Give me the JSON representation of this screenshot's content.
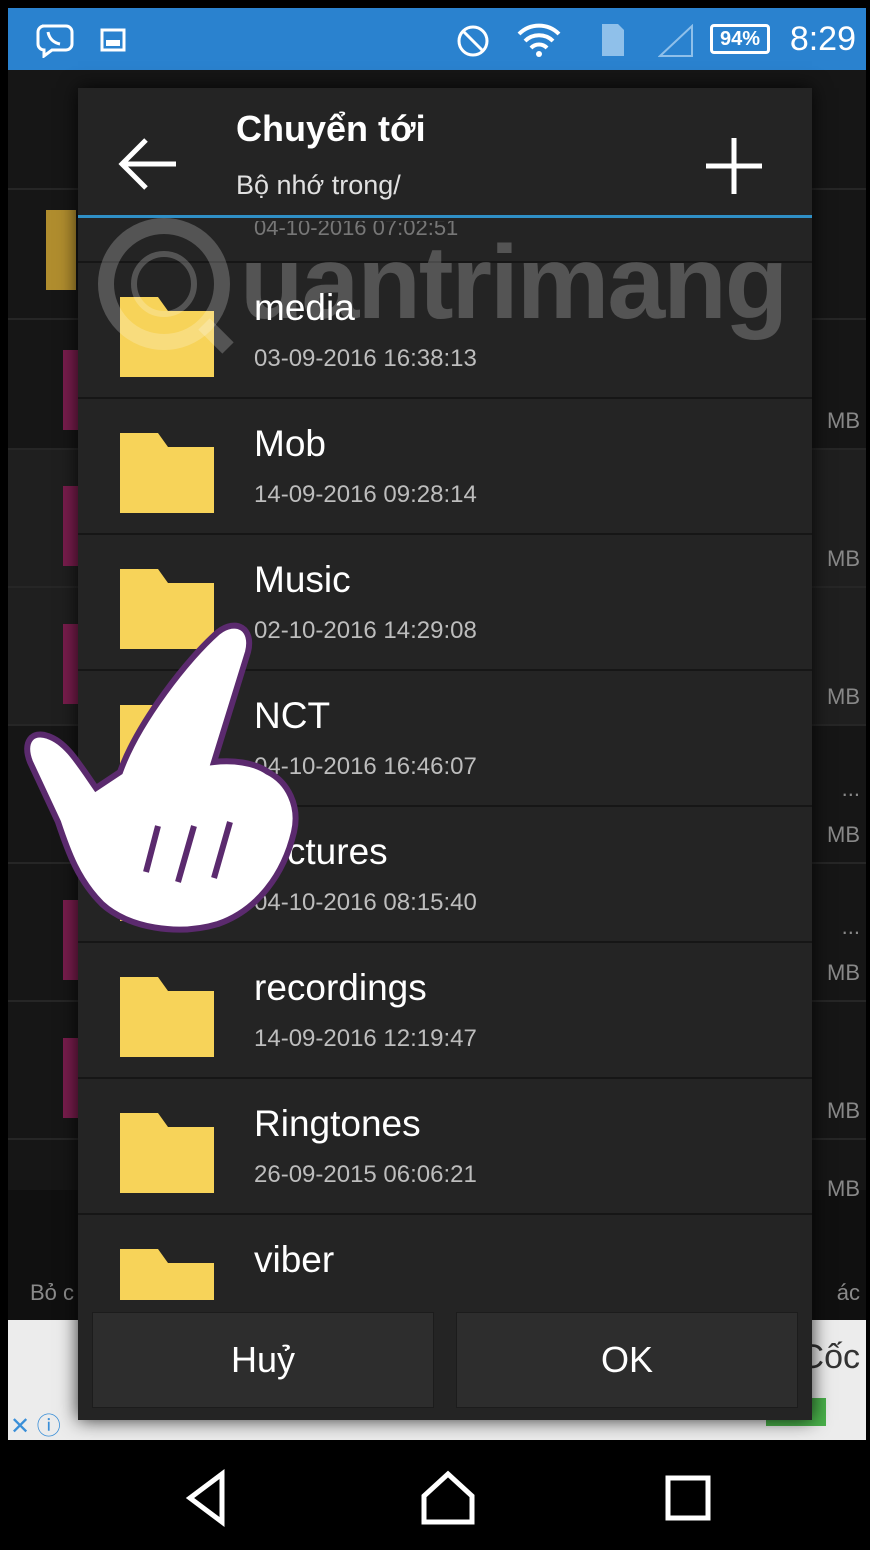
{
  "status_bar": {
    "time": "8:29",
    "battery": "94%",
    "icons": [
      "viber-icon",
      "image-notification-icon",
      "do-not-disturb-icon",
      "wifi-icon",
      "sim-icon",
      "signal-icon"
    ],
    "background": "#2a82cf"
  },
  "background_app": {
    "sizes": [
      "MB",
      "MB",
      "MB",
      "MB",
      "MB",
      "MB",
      "MB"
    ],
    "ellipsis": [
      "...",
      "..."
    ],
    "bottom_labels": [
      "Bỏ c",
      "ác"
    ],
    "ad_text": "Cốc"
  },
  "dialog": {
    "title": "Chuyển tới",
    "path": "Bộ nhớ trong/",
    "partial_top_item_date": "04-10-2016 07:02:51",
    "items": [
      {
        "name": "media",
        "date": "03-09-2016 16:38:13"
      },
      {
        "name": "Mob",
        "date": "14-09-2016 09:28:14"
      },
      {
        "name": "Music",
        "date": "02-10-2016 14:29:08"
      },
      {
        "name": "NCT",
        "date": "04-10-2016 16:46:07"
      },
      {
        "name": "Pictures",
        "date": "04-10-2016 08:15:40"
      },
      {
        "name": "recordings",
        "date": "14-09-2016 12:19:47"
      },
      {
        "name": "Ringtones",
        "date": "26-09-2015 06:06:21"
      },
      {
        "name": "viber",
        "date": ""
      }
    ],
    "cancel_label": "Huỷ",
    "ok_label": "OK",
    "accent_color": "#2f8fc6",
    "folder_color": "#f7d359"
  },
  "watermark": {
    "text": "uantrimang"
  },
  "nav_bar": {
    "buttons": [
      "back-icon",
      "home-icon",
      "recents-icon"
    ]
  }
}
